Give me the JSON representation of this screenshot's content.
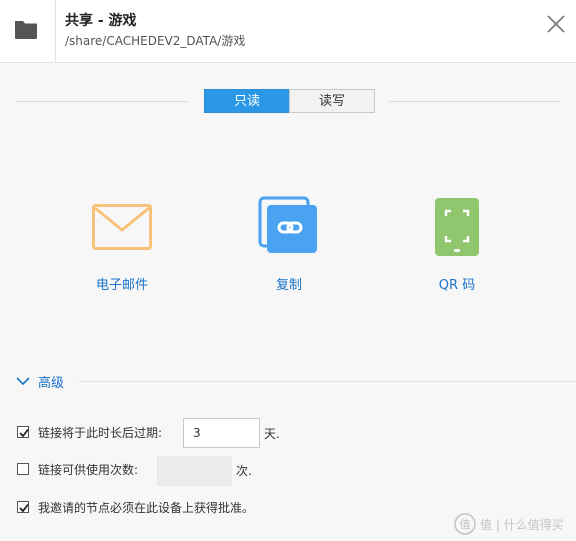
{
  "header": {
    "title": "共享 - 游戏",
    "path": "/share/CACHEDEV2_DATA/游戏"
  },
  "mode": {
    "readonly_label": "只读",
    "readwrite_label": "读写",
    "selected": "readonly"
  },
  "share_options": [
    {
      "label": "电子邮件",
      "icon": "mail-icon",
      "color": "#f9c27a"
    },
    {
      "label": "复制",
      "icon": "copy-link-icon",
      "color": "#4aa3f0"
    },
    {
      "label": "QR 码",
      "icon": "qr-phone-icon",
      "color": "#8fc66e"
    }
  ],
  "advanced": {
    "label": "高级",
    "expanded": true,
    "options": {
      "expire": {
        "label": "链接将于此时长后过期:",
        "checked": true,
        "value": "3",
        "unit": "天."
      },
      "usage": {
        "label": "链接可供使用次数:",
        "checked": false,
        "value": "",
        "unit": "次."
      },
      "approval": {
        "label": "我邀请的节点必须在此设备上获得批准。",
        "checked": true
      }
    }
  },
  "watermark": {
    "text": "值 | 什么值得买"
  },
  "colors": {
    "accent": "#2a98e6",
    "link": "#1a73c7",
    "background": "#f7f7f7"
  }
}
